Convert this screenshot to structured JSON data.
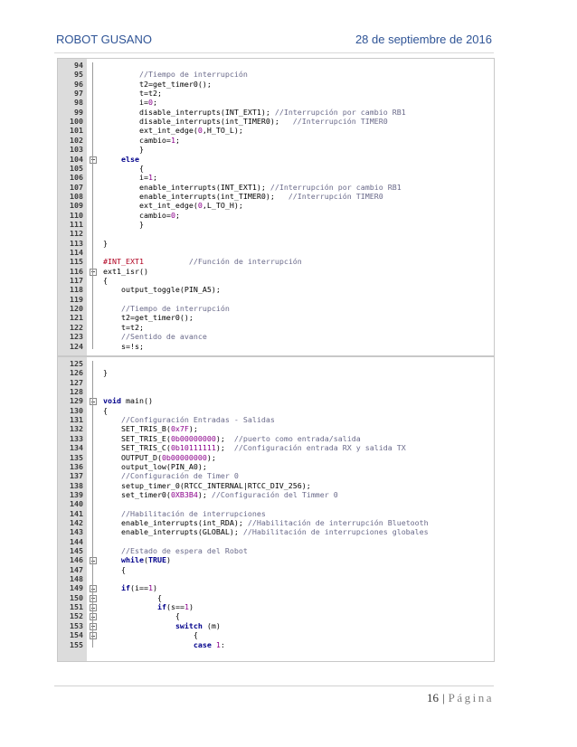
{
  "header": {
    "left": "ROBOT GUSANO",
    "right": "28 de septiembre de 2016"
  },
  "block1": [
    {
      "n": "94",
      "t": ""
    },
    {
      "n": "95",
      "t": "        //Tiempo de interrupción"
    },
    {
      "n": "96",
      "t": "        t2=get_timer0();"
    },
    {
      "n": "97",
      "t": "        t=t2;"
    },
    {
      "n": "98",
      "t": "        i=0;"
    },
    {
      "n": "99",
      "t": "        disable_interrupts(INT_EXT1); //Interrupción por cambio RB1"
    },
    {
      "n": "100",
      "t": "        disable_interrupts(int_TIMER0);   //Interrupción TIMER0"
    },
    {
      "n": "101",
      "t": "        ext_int_edge(0,H_TO_L);"
    },
    {
      "n": "102",
      "t": "        cambio=1;"
    },
    {
      "n": "103",
      "t": "        }"
    },
    {
      "n": "104",
      "t": "    else"
    },
    {
      "n": "105",
      "t": "        {"
    },
    {
      "n": "106",
      "t": "        i=1;"
    },
    {
      "n": "107",
      "t": "        enable_interrupts(INT_EXT1); //Interrupción por cambio RB1"
    },
    {
      "n": "108",
      "t": "        enable_interrupts(int_TIMER0);   //Interrupción TIMER0"
    },
    {
      "n": "109",
      "t": "        ext_int_edge(0,L_TO_H);"
    },
    {
      "n": "110",
      "t": "        cambio=0;"
    },
    {
      "n": "111",
      "t": "        }"
    },
    {
      "n": "112",
      "t": ""
    },
    {
      "n": "113",
      "t": "}"
    },
    {
      "n": "114",
      "t": ""
    },
    {
      "n": "115",
      "t": "#INT_EXT1          //Función de interrupción"
    },
    {
      "n": "116",
      "t": "ext1_isr()"
    },
    {
      "n": "117",
      "t": "{"
    },
    {
      "n": "118",
      "t": "    output_toggle(PIN_A5);"
    },
    {
      "n": "119",
      "t": ""
    },
    {
      "n": "120",
      "t": "    //Tiempo de interrupción"
    },
    {
      "n": "121",
      "t": "    t2=get_timer0();"
    },
    {
      "n": "122",
      "t": "    t=t2;"
    },
    {
      "n": "123",
      "t": "    //Sentido de avance"
    },
    {
      "n": "124",
      "t": "    s=!s;"
    }
  ],
  "block2": [
    {
      "n": "125",
      "t": ""
    },
    {
      "n": "126",
      "t": "}"
    },
    {
      "n": "127",
      "t": ""
    },
    {
      "n": "128",
      "t": ""
    },
    {
      "n": "129",
      "t": "void main()"
    },
    {
      "n": "130",
      "t": "{"
    },
    {
      "n": "131",
      "t": "    //Configuración Entradas - Salidas"
    },
    {
      "n": "132",
      "t": "    SET_TRIS_B(0x7F);"
    },
    {
      "n": "133",
      "t": "    SET_TRIS_E(0b00000000);  //puerto como entrada/salida"
    },
    {
      "n": "134",
      "t": "    SET_TRIS_C(0b10111111);  //Configuración entrada RX y salida TX"
    },
    {
      "n": "135",
      "t": "    OUTPUT_D(0b00000000);"
    },
    {
      "n": "136",
      "t": "    output_low(PIN_A0);"
    },
    {
      "n": "137",
      "t": "    //Configuración de Timer 0"
    },
    {
      "n": "138",
      "t": "    setup_timer_0(RTCC_INTERNAL|RTCC_DIV_256);"
    },
    {
      "n": "139",
      "t": "    set_timer0(0XB3B4); //Configuración del Timmer 0"
    },
    {
      "n": "140",
      "t": ""
    },
    {
      "n": "141",
      "t": "    //Habilitación de interrupciones"
    },
    {
      "n": "142",
      "t": "    enable_interrupts(int_RDA); //Habilitación de interrupción Bluetooth"
    },
    {
      "n": "143",
      "t": "    enable_interrupts(GLOBAL); //Habilitación de interrupciones globales"
    },
    {
      "n": "144",
      "t": ""
    },
    {
      "n": "145",
      "t": "    //Estado de espera del Robot"
    },
    {
      "n": "146",
      "t": "    while(TRUE)"
    },
    {
      "n": "147",
      "t": "    {"
    },
    {
      "n": "148",
      "t": ""
    },
    {
      "n": "149",
      "t": "    if(i==1)"
    },
    {
      "n": "150",
      "t": "            {"
    },
    {
      "n": "151",
      "t": "            if(s==1)"
    },
    {
      "n": "152",
      "t": "                {"
    },
    {
      "n": "153",
      "t": "                switch (m)"
    },
    {
      "n": "154",
      "t": "                    {"
    },
    {
      "n": "155",
      "t": "                    case 1:"
    }
  ],
  "footer": {
    "page": "16",
    "separator": "|",
    "word": "Página"
  }
}
